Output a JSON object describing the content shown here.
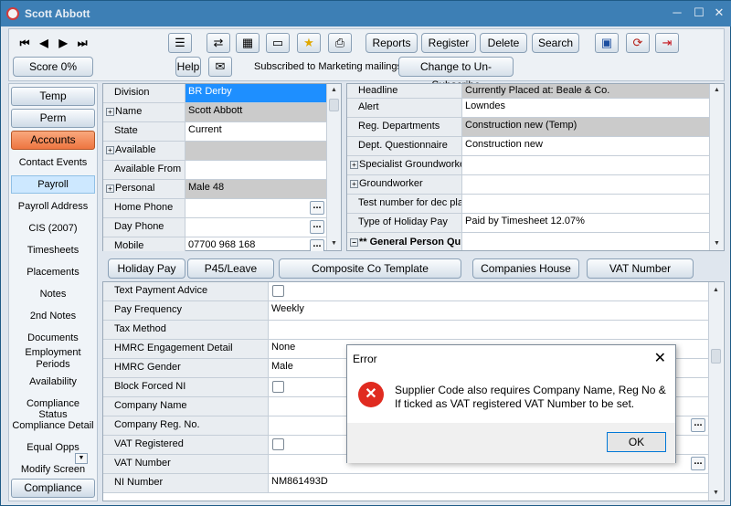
{
  "window": {
    "title": "Scott Abbott",
    "minimize": "─",
    "restore": "☐",
    "close": "✕"
  },
  "toolbar": {
    "nav": {
      "first": "⏮",
      "prev": "◀",
      "next": "▶",
      "last": "⏭"
    },
    "score_label": "Score 0%",
    "help_label": "Help",
    "subscription_text": "Subscribed to Marketing mailings",
    "unsubscribe_label": "Change to Un-Subscribe",
    "reports_label": "Reports",
    "register_label": "Register",
    "delete_label": "Delete",
    "search_label": "Search",
    "icons": [
      {
        "name": "document-list-icon",
        "glyph": "☰"
      },
      {
        "name": "transfer-icon",
        "glyph": "⇄"
      },
      {
        "name": "calendar-icon",
        "glyph": "▦"
      },
      {
        "name": "note-icon",
        "glyph": "▭"
      },
      {
        "name": "star-icon",
        "glyph": "★"
      },
      {
        "name": "printer-icon",
        "glyph": "⎙"
      }
    ],
    "right_icons": [
      {
        "name": "save-record-icon",
        "glyph": "▣"
      },
      {
        "name": "refresh-icon",
        "glyph": "⟳"
      },
      {
        "name": "exit-icon",
        "glyph": "⇥"
      }
    ]
  },
  "sidebar": {
    "buttons": [
      {
        "label": "Temp"
      },
      {
        "label": "Perm"
      },
      {
        "label": "Accounts"
      }
    ],
    "items": [
      {
        "label": "Contact Events"
      },
      {
        "label": "Payroll"
      },
      {
        "label": "Payroll Address"
      },
      {
        "label": "CIS (2007)"
      },
      {
        "label": "Timesheets"
      },
      {
        "label": "Placements"
      },
      {
        "label": "Notes"
      },
      {
        "label": "2nd Notes"
      },
      {
        "label": "Documents"
      },
      {
        "label": "Employment Periods"
      },
      {
        "label": "Availability"
      },
      {
        "label": "Compliance Status"
      },
      {
        "label": "Compliance Detail"
      },
      {
        "label": "Equal Opps"
      },
      {
        "label": "Modify Screen"
      }
    ],
    "compliance_label": "Compliance"
  },
  "left_grid": [
    {
      "label": "Division",
      "value": "BR Derby",
      "style": "blue"
    },
    {
      "label": "Name",
      "value": "Scott Abbott",
      "style": "gray",
      "expand": true
    },
    {
      "label": "State",
      "value": "Current",
      "style": ""
    },
    {
      "label": "Available",
      "value": "",
      "style": "gray",
      "expand": true
    },
    {
      "label": "Available From",
      "value": "",
      "style": ""
    },
    {
      "label": "Personal",
      "value": "Male 48",
      "style": "gray",
      "expand": true
    },
    {
      "label": "Home Phone",
      "value": "",
      "style": "",
      "ellipsis": true
    },
    {
      "label": "Day Phone",
      "value": "",
      "style": "",
      "ellipsis": true
    },
    {
      "label": "Mobile",
      "value": "07700 968 168",
      "style": "",
      "ellipsis": true
    }
  ],
  "right_grid": [
    {
      "label": "Headline",
      "value": "Currently Placed at: Beale & Co.",
      "style": "gray"
    },
    {
      "label": "Alert",
      "value": "Lowndes",
      "style": ""
    },
    {
      "label": "Reg. Departments",
      "value": "Construction new (Temp)",
      "style": "gray"
    },
    {
      "label": "Dept. Questionnaire",
      "value": "Construction new",
      "style": ""
    },
    {
      "label": "Specialist Groundworke",
      "value": "",
      "style": "",
      "expand": true
    },
    {
      "label": "Groundworker",
      "value": "",
      "style": "",
      "expand": true
    },
    {
      "label": "Test number for dec pla",
      "value": "",
      "style": ""
    },
    {
      "label": "Type of Holiday Pay",
      "value": "Paid by Timesheet 12.07%",
      "style": ""
    },
    {
      "label": "** General Person Qu",
      "value": "",
      "style": "",
      "collapse": true
    }
  ],
  "tabs": [
    {
      "label": "Holiday Pay"
    },
    {
      "label": "P45/Leave"
    },
    {
      "label": "Composite Co Template Maintenance"
    },
    {
      "label": "Companies House"
    },
    {
      "label": "VAT Number"
    }
  ],
  "payroll_grid": [
    {
      "label": "Text Payment Advice",
      "value": "",
      "checkbox": true
    },
    {
      "label": "Pay Frequency",
      "value": "Weekly"
    },
    {
      "label": "Tax Method",
      "value": ""
    },
    {
      "label": "HMRC Engagement Detail",
      "value": "None"
    },
    {
      "label": "HMRC Gender",
      "value": "Male"
    },
    {
      "label": "Block Forced NI",
      "value": "",
      "checkbox": true
    },
    {
      "label": "Company Name",
      "value": ""
    },
    {
      "label": "Company Reg. No.",
      "value": "",
      "ellipsis": true
    },
    {
      "label": "VAT Registered",
      "value": "",
      "checkbox": true
    },
    {
      "label": "VAT Number",
      "value": "",
      "ellipsis": true
    },
    {
      "label": "NI Number",
      "value": "NM861493D"
    }
  ],
  "dialog": {
    "title": "Error",
    "close": "✕",
    "icon": "✕",
    "message": "Supplier Code also requires Company Name, Reg No & If ticked as VAT registered VAT Number to be set.",
    "ok_label": "OK"
  },
  "scroll": {
    "up": "▲",
    "down": "▼"
  },
  "ellipsis": "...",
  "expand_sign": "+",
  "collapse_sign": "−",
  "colors": {
    "accent": "#ee7540",
    "selected": "#1e8fff",
    "error": "#e02b20"
  }
}
